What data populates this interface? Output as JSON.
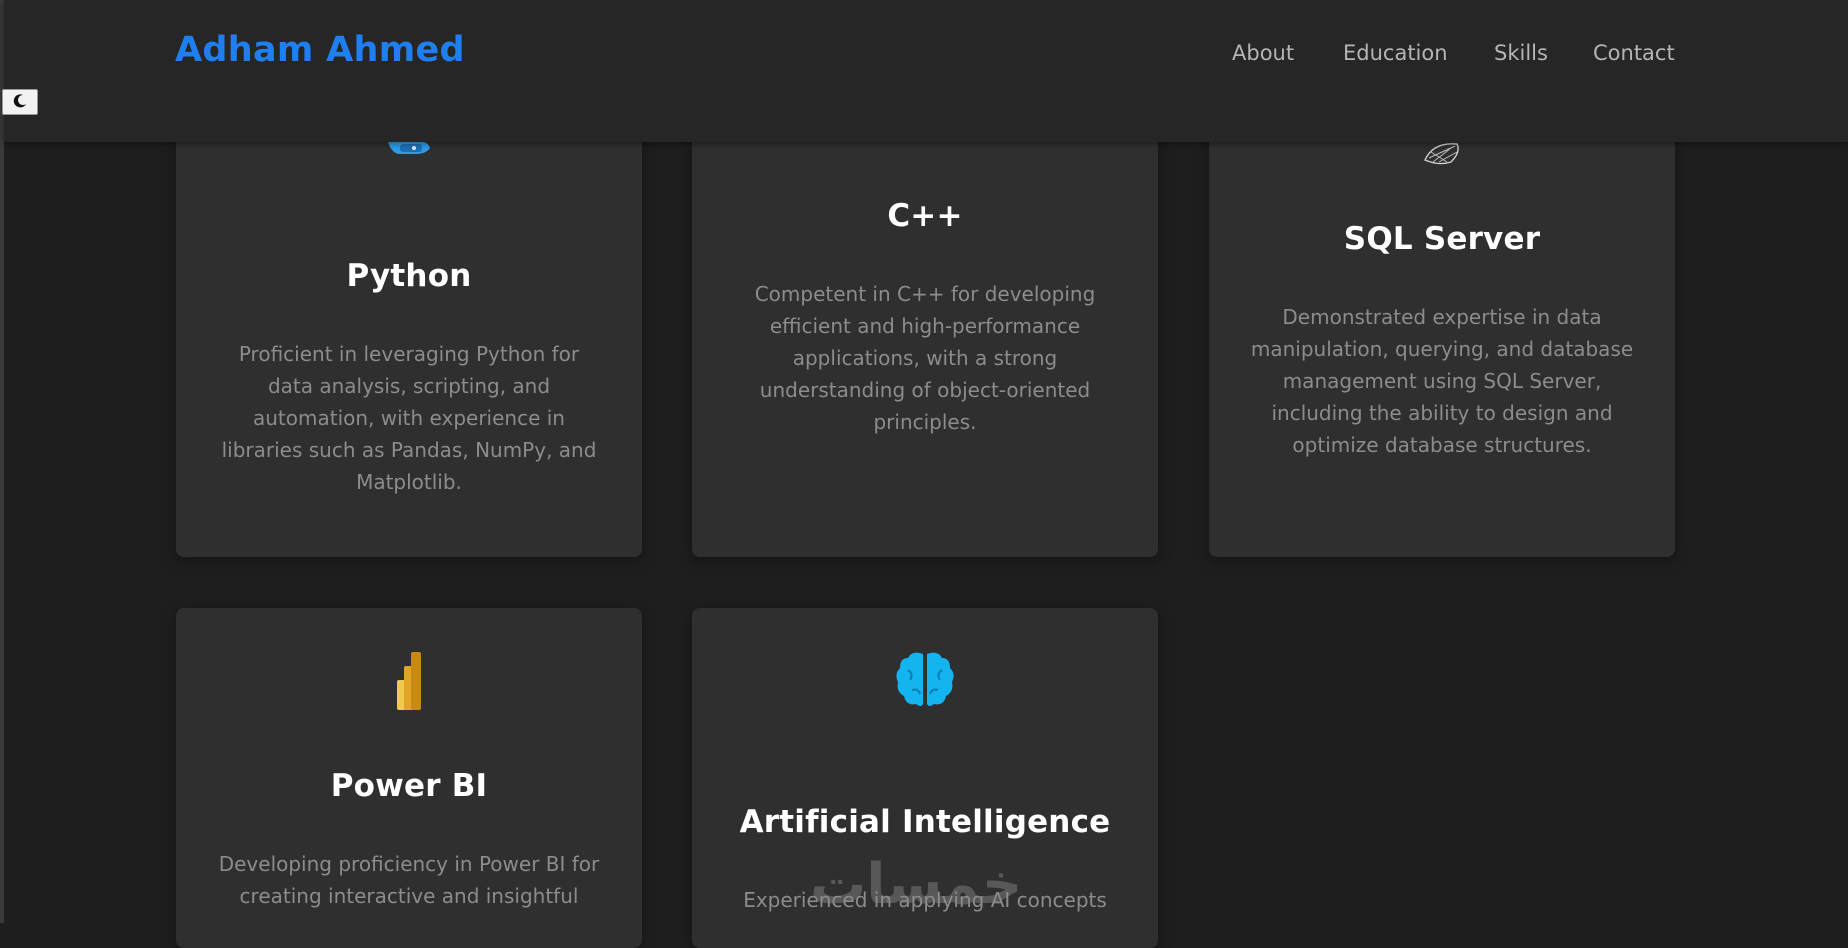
{
  "header": {
    "brand": "Adham Ahmed",
    "nav": {
      "about": "About",
      "education": "Education",
      "skills": "Skills",
      "contact": "Contact"
    }
  },
  "theme_toggle": {
    "icon": "moon-icon"
  },
  "skills": [
    {
      "title": "Python",
      "description": "Proficient in leveraging Python for data analysis, scripting, and automation, with experience in libraries such as Pandas, NumPy, and Matplotlib.",
      "icon": "python-icon"
    },
    {
      "title": "C++",
      "description": "Competent in C++ for developing efficient and high-performance applications, with a strong understanding of object-oriented principles.",
      "icon": "cpp-icon"
    },
    {
      "title": "SQL Server",
      "description": "Demonstrated expertise in data manipulation, querying, and database management using SQL Server, including the ability to design and optimize database structures.",
      "icon": "sql-server-icon"
    },
    {
      "title": "Power BI",
      "description": "Developing proficiency in Power BI for creating interactive and insightful",
      "icon": "power-bi-icon"
    },
    {
      "title": "Artificial Intelligence",
      "description": "Experienced in applying AI concepts",
      "icon": "brain-icon"
    }
  ],
  "watermark": "خمسات",
  "colors": {
    "accent": "#1f7ef0",
    "background": "#1e1e1e",
    "card": "#2f2f2f",
    "header": "#262626",
    "muted_text": "#8c8c8c"
  }
}
